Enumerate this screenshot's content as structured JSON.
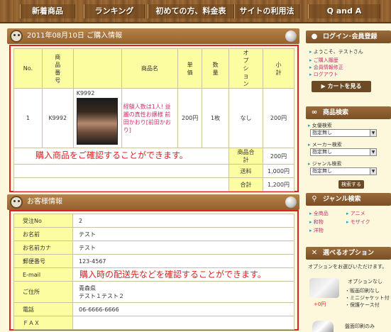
{
  "nav": {
    "tabs": [
      "新着商品",
      "ランキング",
      "初めての方、料金表",
      "サイトの利用法",
      "Q and A"
    ]
  },
  "order_section": {
    "title": "2011年08月10日 ご購入情報",
    "headers": [
      "No.",
      "商品番号",
      "",
      "商品名",
      "単価",
      "数量",
      "オプション",
      "小計"
    ],
    "row": {
      "no": "1",
      "product_code": "K9992",
      "image_code": "K9992",
      "product_name": "経験人数は1人! 益麗の真性お嬢様 前田かおり[前田かおり]",
      "unit_price": "200円",
      "quantity": "1枚",
      "option": "なし",
      "subtotal": "200円"
    },
    "totals": [
      {
        "label": "商品合計",
        "value": "200円"
      },
      {
        "label": "送料",
        "value": "1,000円"
      },
      {
        "label": "合計",
        "value": "1,200円"
      }
    ],
    "note": "購入商品をご確認することができます。"
  },
  "customer_section": {
    "title": "お客様情報",
    "rows": [
      {
        "label": "受注No",
        "value": "2"
      },
      {
        "label": "お名前",
        "value": "テスト"
      },
      {
        "label": "お名前カナ",
        "value": "テスト"
      },
      {
        "label": "郵便番号",
        "value": "123-4567"
      },
      {
        "label": "E-mail",
        "value": ""
      },
      {
        "label": "ご住所",
        "value": "青森県",
        "value2": "テスト１テスト２"
      },
      {
        "label": "電話",
        "value": "06-6666-6666"
      },
      {
        "label": "ＦＡＸ",
        "value": ""
      }
    ],
    "note": "購入時の配送先などを確認することができます。"
  },
  "sidebar": {
    "login": {
      "title": "ログイン･会員登録",
      "welcome": "ようこそ、テストさん",
      "links": [
        "ご購入履歴",
        "会員情報修正",
        "ログアウト"
      ],
      "cart_button": "カートを見る"
    },
    "search": {
      "title": "商品検索",
      "fields": [
        {
          "label": "女優検索",
          "value": "指定無し"
        },
        {
          "label": "メーカー検索",
          "value": "指定無し"
        },
        {
          "label": "ジャンル検索",
          "value": "指定無し"
        }
      ],
      "button": "検索する"
    },
    "genre": {
      "title": "ジャンル検索",
      "items": [
        "全商品",
        "アニメ",
        "和物",
        "モザイク",
        "洋物"
      ]
    },
    "options": {
      "title": "選べるオプション",
      "subtitle": "オプションをお選びいただけます。",
      "option1_title": "オプションなし",
      "option1_items": [
        "・販画印刷なし",
        "・ミニジャケット付",
        "・保護ケース付"
      ],
      "option1_price": "+0円",
      "option2_title": "盤面印刷のみ"
    }
  },
  "colors": {
    "accent_red": "#e02020",
    "header_yellow": "#fcfca0",
    "wood": "#94612e",
    "link_pink": "#c03070"
  }
}
